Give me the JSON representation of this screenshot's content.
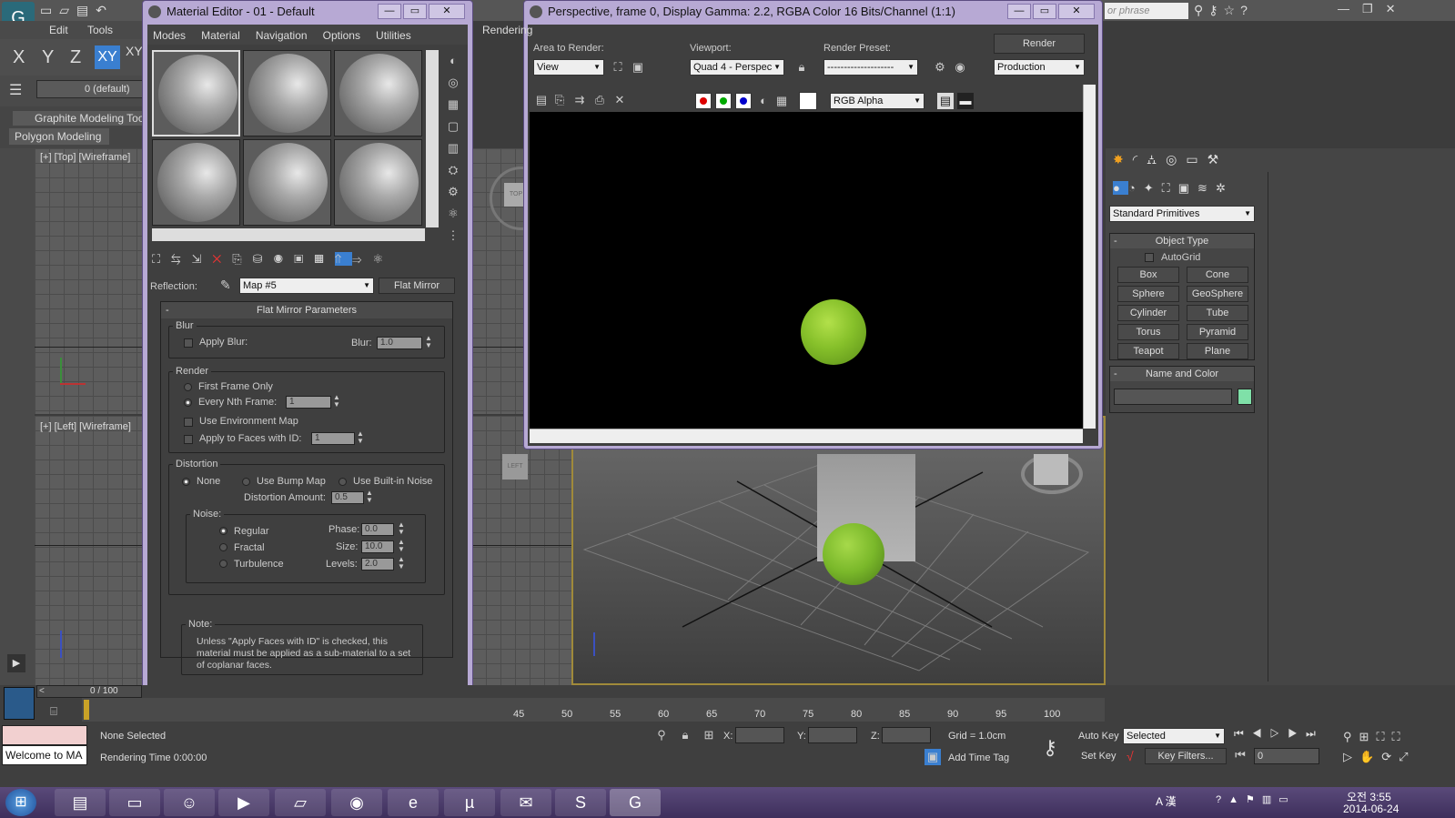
{
  "app": {
    "menu": [
      "Edit",
      "Tools",
      "Rendering"
    ],
    "axis_buttons": [
      "X",
      "Y",
      "Z",
      "XY",
      "XY"
    ],
    "layer_label": "0 (default)",
    "ribbon_tabs": [
      "Graphite Modeling Tools",
      "Polygon Modeling"
    ],
    "search_placeholder": "or phrase",
    "viewport_top_label": "[+] [Top] [Wireframe]",
    "viewport_left_label": "[+] [Left] [Wireframe]",
    "viewcube_top": "TOP",
    "viewcube_left": "LEFT"
  },
  "material_editor": {
    "title": "Material Editor - 01 - Default",
    "menu": [
      "Modes",
      "Material",
      "Navigation",
      "Options",
      "Utilities"
    ],
    "reflection_label": "Reflection:",
    "map_name": "Map #5",
    "map_type": "Flat Mirror",
    "rollout_title": "Flat Mirror Parameters",
    "blur": {
      "group": "Blur",
      "apply_blur": "Apply Blur:",
      "blur_label": "Blur:",
      "blur_value": "1.0"
    },
    "render": {
      "group": "Render",
      "first_frame": "First Frame Only",
      "every_nth": "Every Nth Frame:",
      "every_nth_value": "1",
      "use_env_map": "Use Environment Map",
      "apply_faces": "Apply to Faces with ID:",
      "apply_faces_value": "1"
    },
    "distortion": {
      "group": "Distortion",
      "none": "None",
      "use_bump": "Use Bump Map",
      "use_noise": "Use Built-in Noise",
      "amount_label": "Distortion Amount:",
      "amount_value": "0.5"
    },
    "noise": {
      "group": "Noise:",
      "regular": "Regular",
      "fractal": "Fractal",
      "turbulence": "Turbulence",
      "phase_label": "Phase:",
      "phase_value": "0.0",
      "size_label": "Size:",
      "size_value": "10.0",
      "levels_label": "Levels:",
      "levels_value": "2.0"
    },
    "note": {
      "title": "Note:",
      "text": "Unless \"Apply Faces with ID\" is checked, this material must be applied as a sub-material to a set of coplanar faces."
    }
  },
  "render_window": {
    "title": "Perspective, frame 0, Display Gamma: 2.2, RGBA Color 16 Bits/Channel (1:1)",
    "area_label": "Area to Render:",
    "area_value": "View",
    "viewport_label": "Viewport:",
    "viewport_value": "Quad 4 - Perspec",
    "preset_label": "Render Preset:",
    "preset_value": "--------------------",
    "render_button": "Render",
    "mode_value": "Production",
    "channel_value": "RGB Alpha"
  },
  "command_panel": {
    "category": "Standard Primitives",
    "object_type_title": "Object Type",
    "autogrid": "AutoGrid",
    "buttons": [
      "Box",
      "Cone",
      "Sphere",
      "GeoSphere",
      "Cylinder",
      "Tube",
      "Torus",
      "Pyramid",
      "Teapot",
      "Plane"
    ],
    "name_color_title": "Name and Color",
    "swatch_color": "#7fe0a8"
  },
  "timeline": {
    "frame_counter": "0 / 100",
    "ticks": [
      "45",
      "50",
      "55",
      "60",
      "65",
      "70",
      "75",
      "80",
      "85",
      "90",
      "95",
      "100"
    ]
  },
  "status": {
    "welcome": "Welcome to MA",
    "selection": "None Selected",
    "rendering_time": "Rendering Time 0:00:00",
    "x_label": "X:",
    "y_label": "Y:",
    "z_label": "Z:",
    "grid": "Grid = 1.0cm",
    "add_time_tag": "Add Time Tag",
    "auto_key": "Auto Key",
    "set_key": "Set Key",
    "selected_value": "Selected",
    "key_filters": "Key Filters...",
    "frame_field": "0"
  },
  "taskbar": {
    "time": "오전 3:55",
    "date": "2014-06-24",
    "ime": "A 漢"
  }
}
